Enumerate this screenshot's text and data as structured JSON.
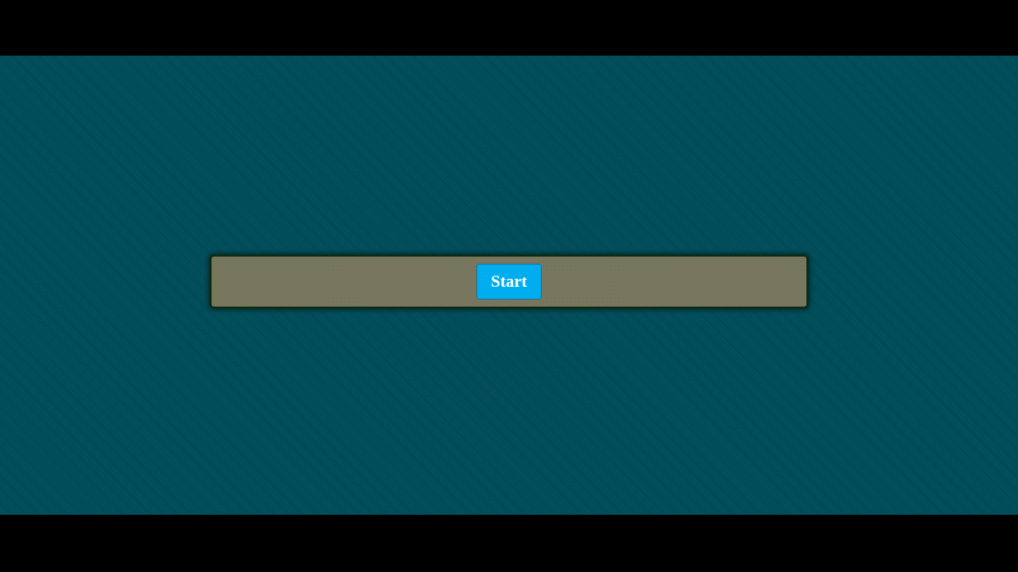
{
  "toolbar": {
    "buttons": [
      {
        "label": "Start"
      }
    ]
  }
}
